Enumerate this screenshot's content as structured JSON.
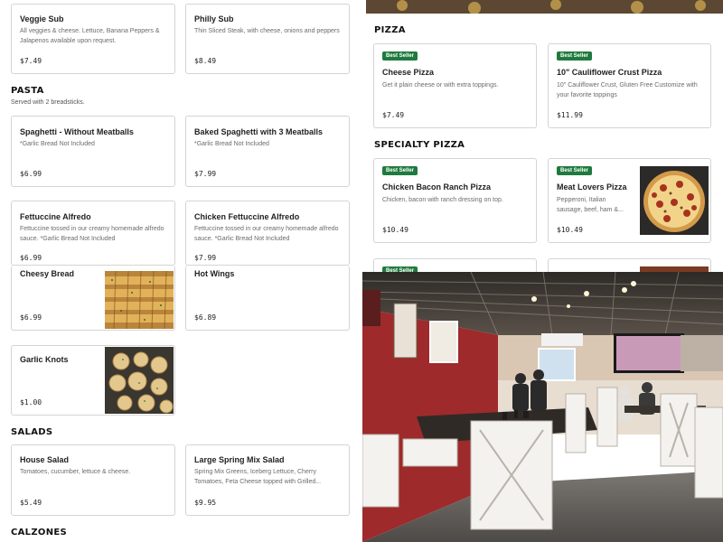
{
  "left": {
    "subs": [
      {
        "name": "Veggie Sub",
        "desc": "All veggies & cheese. Lettuce, Banana Peppers & Jalapenos available upon request.",
        "price": "$7.49"
      },
      {
        "name": "Philly Sub",
        "desc": "Thin Sliced Steak, with cheese, onions and peppers",
        "price": "$8.49"
      }
    ],
    "pasta": {
      "title": "PASTA",
      "subtitle": "Served with 2 breadsticks.",
      "items": [
        {
          "name": "Spaghetti - Without Meatballs",
          "desc": "*Garlic Bread Not Included",
          "price": "$6.99"
        },
        {
          "name": "Baked Spaghetti with 3 Meatballs",
          "desc": "*Garlic Bread Not Included",
          "price": "$7.99"
        },
        {
          "name": "Fettuccine Alfredo",
          "desc": "Fettuccine tossed in our creamy homemade alfredo sauce. *Garlic Bread Not Included",
          "price": "$6.99"
        },
        {
          "name": "Chicken Fettuccine Alfredo",
          "desc": "Fettuccine tossed in our creamy homemade alfredo sauce. *Garlic Bread Not Included",
          "price": "$7.99"
        }
      ]
    },
    "sides": [
      {
        "name": "Cheesy Bread",
        "price": "$6.99"
      },
      {
        "name": "Hot Wings",
        "price": "$6.89"
      },
      {
        "name": "Garlic Knots",
        "price": "$1.00"
      }
    ],
    "salads": {
      "title": "SALADS",
      "items": [
        {
          "name": "House Salad",
          "desc": "Tomatoes, cucumber, lettuce & cheese.",
          "price": "$5.49"
        },
        {
          "name": "Large Spring Mix Salad",
          "desc": "Spring Mix Greens, Iceberg Lettuce, Cherry Tomatoes, Feta Cheese topped with Grilled...",
          "price": "$9.95"
        }
      ]
    },
    "calzones": {
      "title": "CALZONES"
    }
  },
  "right": {
    "pizza": {
      "title": "PIZZA",
      "items": [
        {
          "badge": "Best Seller",
          "name": "Cheese Pizza",
          "desc": "Get it plain cheese or with extra toppings.",
          "price": "$7.49"
        },
        {
          "badge": "Best Seller",
          "name": "10\" Cauliflower Crust Pizza",
          "desc": "10\" Cauliflower Crust, Gluten Free Customize with your favorite toppings",
          "price": "$11.99"
        }
      ]
    },
    "specialty": {
      "title": "SPECIALTY PIZZA",
      "items": [
        {
          "badge": "Best Seller",
          "name": "Chicken Bacon Ranch Pizza",
          "desc": "Chicken, bacon with ranch dressing on top.",
          "price": "$10.49"
        },
        {
          "badge": "Best Seller",
          "name": "Meat Lovers Pizza",
          "desc": "Pepperoni, Italian sausage, beef, ham &...",
          "price": "$10.49"
        }
      ],
      "partial_badge": "Best Seller"
    }
  },
  "colors": {
    "badge": "#1e7a3d",
    "border": "#d4d4d4",
    "wall_red": "#9e2a2b"
  },
  "icons": [
    "pizza-photo",
    "cheesy-bread-photo",
    "garlic-knots-photo",
    "restaurant-interior-photo"
  ]
}
